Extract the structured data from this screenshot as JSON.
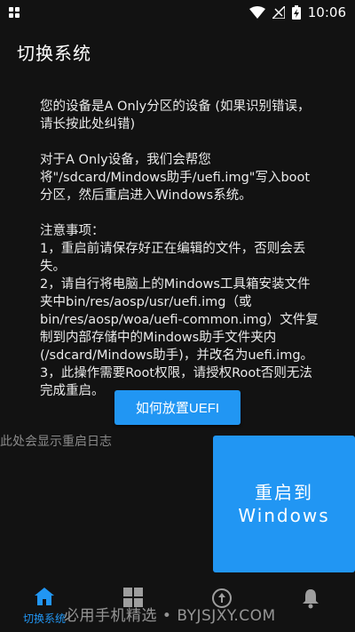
{
  "status_bar": {
    "time": "10:06"
  },
  "app_bar": {
    "title": "切换系统"
  },
  "instructions": {
    "p1": "您的设备是A Only分区的设备 (如果识别错误，请长按此处纠错)",
    "p2": "对于A Only设备，我们会帮您将\"/sdcard/Mindows助手/uefi.img\"写入boot分区，然后重启进入Windows系统。",
    "notes_title": "注意事项：",
    "note1": "1，重启前请保存好正在编辑的文件，否则会丢失。",
    "note2": "2，请自行将电脑上的Mindows工具箱安装文件夹中bin/res/aosp/usr/uefi.img（或bin/res/aosp/woa/uefi-common.img）文件复制到内部存储中的Mindows助手文件夹内(/sdcard/Mindows助手)，并改名为uefi.img。",
    "note3": "3，此操作需要Root权限，请授权Root否则无法完成重启。"
  },
  "uefi_button": {
    "label": "如何放置UEFI"
  },
  "log": {
    "placeholder": "此处会显示重启日志"
  },
  "reboot_button": {
    "line1": "重启到",
    "line2": "Windows"
  },
  "bottom_nav": {
    "items": [
      {
        "label": "切换系统",
        "icon": "home-icon",
        "active": true
      },
      {
        "label": "",
        "icon": "apps-icon",
        "active": false
      },
      {
        "label": "",
        "icon": "update-icon",
        "active": false
      },
      {
        "label": "",
        "icon": "bell-icon",
        "active": false
      }
    ]
  },
  "watermark": "必用手机精选 • BYJSJXY.COM",
  "colors": {
    "accent": "#2196f3",
    "background": "#121212"
  }
}
